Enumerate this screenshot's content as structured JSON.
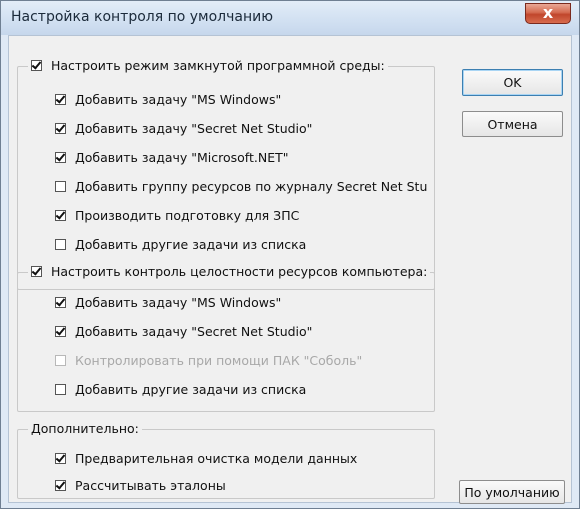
{
  "window": {
    "title": "Настройка контроля по умолчанию",
    "close_glyph": "x"
  },
  "group1": {
    "label": "Настроить режим замкнутой программной среды:",
    "checked": true,
    "items": [
      {
        "label": "Добавить задачу \"MS Windows\"",
        "checked": true,
        "disabled": false
      },
      {
        "label": "Добавить задачу \"Secret Net Studio\"",
        "checked": true,
        "disabled": false
      },
      {
        "label": "Добавить задачу \"Microsoft.NET\"",
        "checked": true,
        "disabled": false
      },
      {
        "label": "Добавить группу ресурсов по журналу Secret Net Stu",
        "checked": false,
        "disabled": false
      },
      {
        "label": "Производить подготовку для ЗПС",
        "checked": true,
        "disabled": false
      },
      {
        "label": "Добавить другие задачи из списка",
        "checked": false,
        "disabled": false
      }
    ]
  },
  "group2": {
    "label": "Настроить контроль целостности ресурсов компьютера:",
    "checked": true,
    "items": [
      {
        "label": "Добавить задачу \"MS Windows\"",
        "checked": true,
        "disabled": false
      },
      {
        "label": "Добавить задачу \"Secret Net Studio\"",
        "checked": true,
        "disabled": false
      },
      {
        "label": "Контролировать при помощи ПАК \"Соболь\"",
        "checked": false,
        "disabled": true
      },
      {
        "label": "Добавить другие задачи из списка",
        "checked": false,
        "disabled": false
      }
    ]
  },
  "group3": {
    "label": "Дополнительно:",
    "items": [
      {
        "label": "Предварительная очистка модели данных",
        "checked": true,
        "disabled": false
      },
      {
        "label": "Рассчитывать эталоны",
        "checked": true,
        "disabled": false
      }
    ]
  },
  "buttons": {
    "ok": "OK",
    "cancel": "Отмена",
    "defaults": "По умолчанию"
  }
}
